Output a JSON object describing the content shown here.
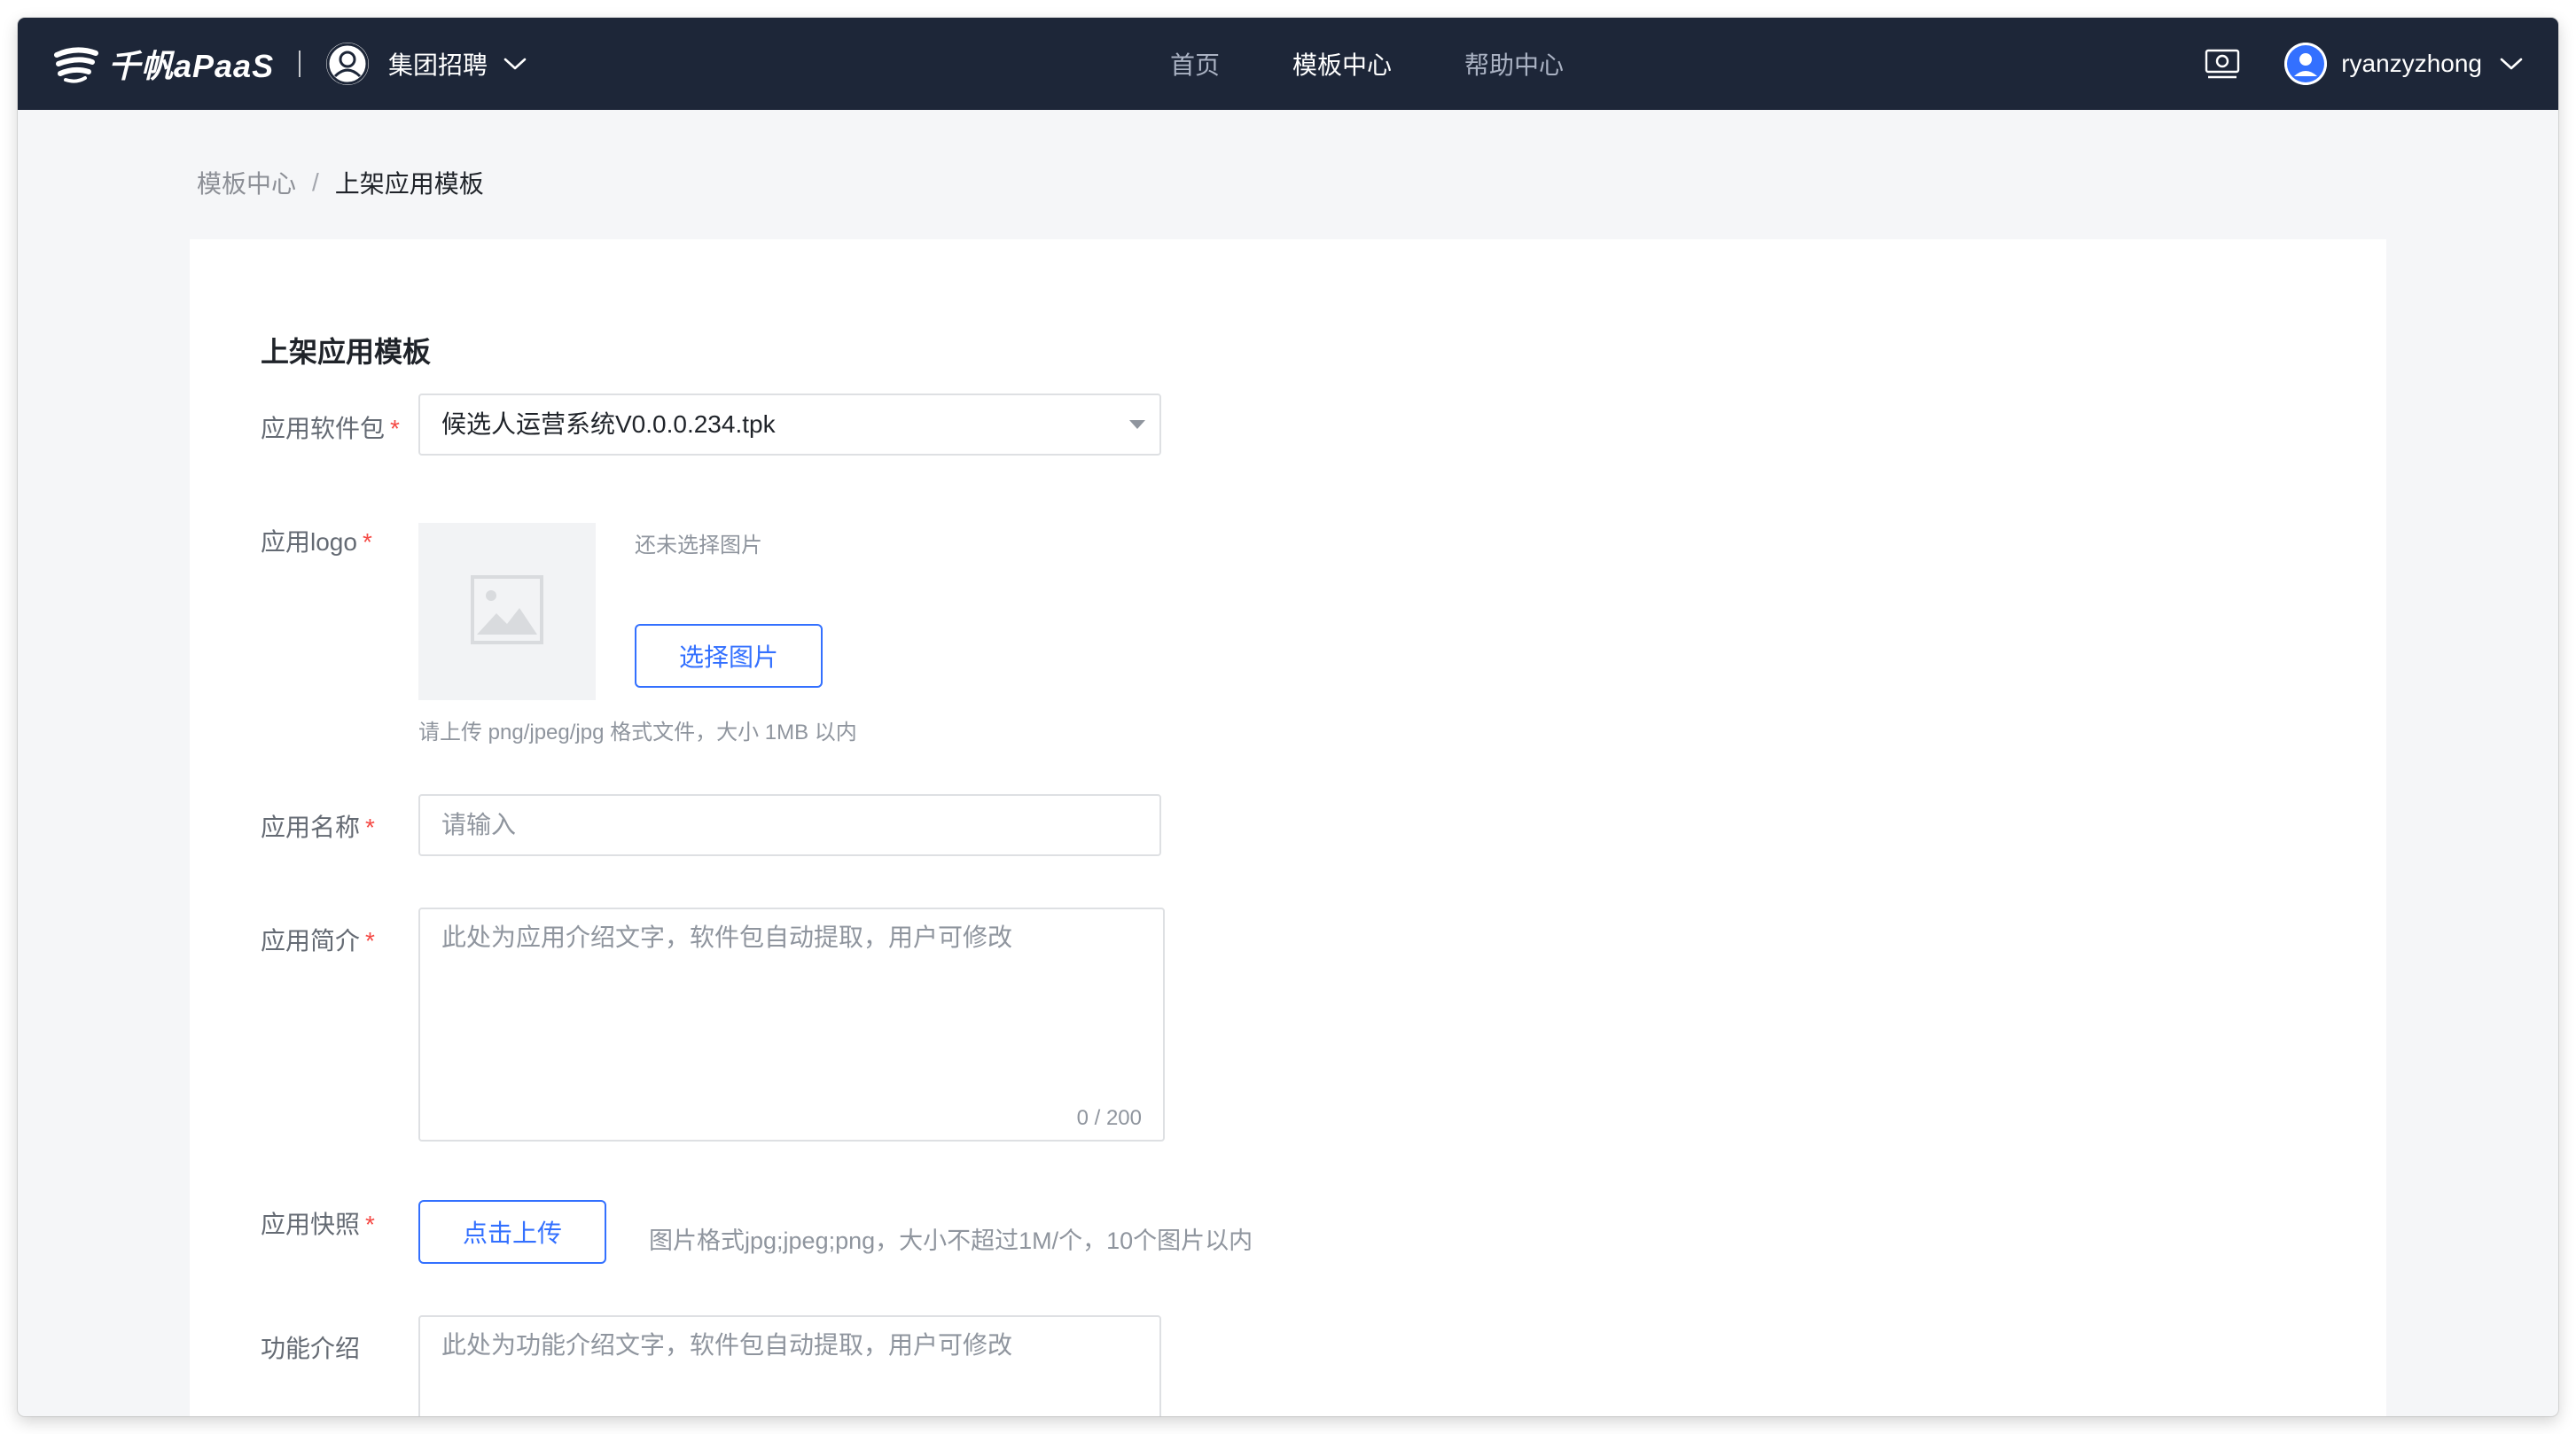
{
  "header": {
    "brand_name": "千帆aPaaS",
    "org_name": "集团招聘",
    "nav": [
      {
        "label": "首页",
        "active": false
      },
      {
        "label": "模板中心",
        "active": true
      },
      {
        "label": "帮助中心",
        "active": false
      }
    ],
    "user_name": "ryanzyzhong"
  },
  "breadcrumb": {
    "parent": "模板中心",
    "separator": "/",
    "current": "上架应用模板"
  },
  "form": {
    "title": "上架应用模板",
    "required_mark": "*",
    "package": {
      "label": "应用软件包",
      "value": "候选人运营系统V0.0.0.234.tpk"
    },
    "logo": {
      "label": "应用logo",
      "status": "还未选择图片",
      "button": "选择图片",
      "hint": "请上传 png/jpeg/jpg 格式文件，大小 1MB 以内"
    },
    "name": {
      "label": "应用名称",
      "placeholder": "请输入"
    },
    "intro": {
      "label": "应用简介",
      "placeholder": "此处为应用介绍文字，软件包自动提取，用户可修改",
      "counter": "0 / 200"
    },
    "snapshot": {
      "label": "应用快照",
      "button": "点击上传",
      "hint": "图片格式jpg;jpeg;png，大小不超过1M/个，10个图片以内"
    },
    "features": {
      "label": "功能介绍",
      "placeholder": "此处为功能介绍文字，软件包自动提取，用户可修改"
    }
  },
  "colors": {
    "topbar": "#1d2638",
    "page_background": "#f5f6f8",
    "accent": "#3370ff",
    "required": "#f54a45"
  }
}
